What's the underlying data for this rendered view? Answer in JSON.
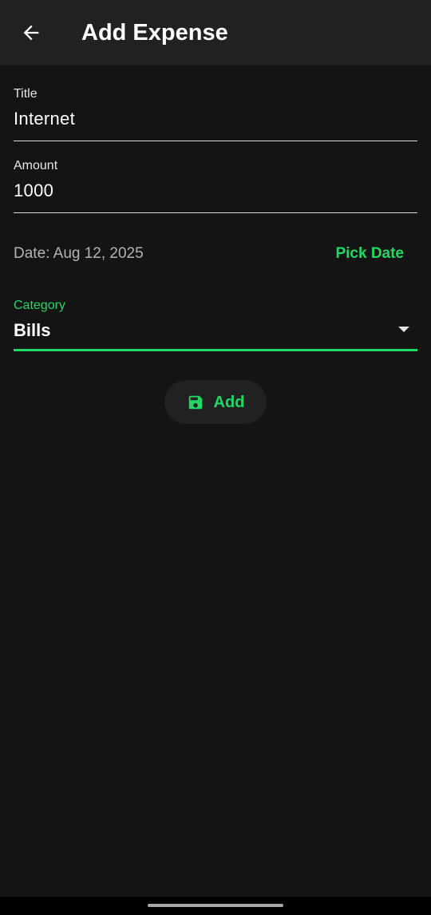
{
  "app_bar": {
    "title": "Add Expense",
    "back_icon": "arrow-back-icon"
  },
  "form": {
    "title_field": {
      "label": "Title",
      "value": "Internet"
    },
    "amount_field": {
      "label": "Amount",
      "value": "1000"
    },
    "date": {
      "text": "Date: Aug 12, 2025",
      "pick_label": "Pick Date"
    },
    "category": {
      "label": "Category",
      "value": "Bills",
      "dropdown_icon": "arrow-drop-down-icon"
    },
    "submit": {
      "label": "Add",
      "icon": "save-icon"
    }
  },
  "colors": {
    "accent": "#1fd866",
    "background": "#141414",
    "app_bar": "#212121",
    "button_bg": "#212121"
  }
}
